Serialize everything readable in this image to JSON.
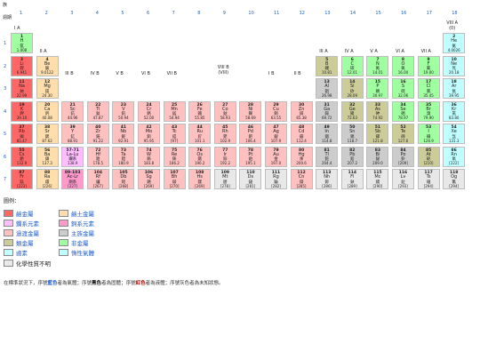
{
  "chart_data": {
    "type": "table",
    "corner_top": "族",
    "corner_period": "週期",
    "groups": [
      "1",
      "2",
      "3",
      "4",
      "5",
      "6",
      "7",
      "8",
      "9",
      "10",
      "11",
      "12",
      "13",
      "14",
      "15",
      "16",
      "17",
      "18"
    ],
    "periods": [
      "1",
      "2",
      "3",
      "4",
      "5",
      "6",
      "7"
    ],
    "group_headers": {
      "1": "I A",
      "2": "II A",
      "3": "III B",
      "4": "IV B",
      "5": "V B",
      "6": "VI B",
      "7": "VII B",
      "9": "VIII B\n(VIII)",
      "11": "I B",
      "12": "II B",
      "13": "III A",
      "14": "IV A",
      "15": "V A",
      "16": "VI A",
      "17": "VII A",
      "18": "VIII A\n(0)"
    },
    "elements": [
      {
        "z": "1",
        "sym": "H",
        "name": "氫",
        "mass": "1.008",
        "g": 1,
        "p": 1,
        "cat": "nonmetal"
      },
      {
        "z": "2",
        "sym": "He",
        "name": "氦",
        "mass": "4.0026",
        "g": 18,
        "p": 1,
        "cat": "noble"
      },
      {
        "z": "3",
        "sym": "Li",
        "name": "鋰",
        "mass": "6.941",
        "g": 1,
        "p": 2,
        "cat": "alkali"
      },
      {
        "z": "4",
        "sym": "Be",
        "name": "鈹",
        "mass": "9.0122",
        "g": 2,
        "p": 2,
        "cat": "alkaline"
      },
      {
        "z": "5",
        "sym": "B",
        "name": "硼",
        "mass": "10.81",
        "g": 13,
        "p": 2,
        "cat": "metalloid"
      },
      {
        "z": "6",
        "sym": "C",
        "name": "碳",
        "mass": "12.01",
        "g": 14,
        "p": 2,
        "cat": "nonmetal"
      },
      {
        "z": "7",
        "sym": "N",
        "name": "氮",
        "mass": "14.01",
        "g": 15,
        "p": 2,
        "cat": "nonmetal"
      },
      {
        "z": "8",
        "sym": "O",
        "name": "氧",
        "mass": "16.00",
        "g": 16,
        "p": 2,
        "cat": "nonmetal"
      },
      {
        "z": "9",
        "sym": "F",
        "name": "氟",
        "mass": "19.00",
        "g": 17,
        "p": 2,
        "cat": "nonmetal"
      },
      {
        "z": "10",
        "sym": "Ne",
        "name": "氖",
        "mass": "20.18",
        "g": 18,
        "p": 2,
        "cat": "noble"
      },
      {
        "z": "11",
        "sym": "Na",
        "name": "鈉",
        "mass": "22.99",
        "g": 1,
        "p": 3,
        "cat": "alkali"
      },
      {
        "z": "12",
        "sym": "Mg",
        "name": "鎂",
        "mass": "24.30",
        "g": 2,
        "p": 3,
        "cat": "alkaline"
      },
      {
        "z": "13",
        "sym": "Al",
        "name": "鋁",
        "mass": "26.98",
        "g": 13,
        "p": 3,
        "cat": "poor"
      },
      {
        "z": "14",
        "sym": "Si",
        "name": "矽",
        "mass": "28.09",
        "g": 14,
        "p": 3,
        "cat": "metalloid"
      },
      {
        "z": "15",
        "sym": "P",
        "name": "磷",
        "mass": "30.97",
        "g": 15,
        "p": 3,
        "cat": "nonmetal"
      },
      {
        "z": "16",
        "sym": "S",
        "name": "硫",
        "mass": "32.06",
        "g": 16,
        "p": 3,
        "cat": "nonmetal"
      },
      {
        "z": "17",
        "sym": "Cl",
        "name": "氯",
        "mass": "35.45",
        "g": 17,
        "p": 3,
        "cat": "nonmetal"
      },
      {
        "z": "18",
        "sym": "Ar",
        "name": "氬",
        "mass": "39.95",
        "g": 18,
        "p": 3,
        "cat": "noble"
      },
      {
        "z": "19",
        "sym": "K",
        "name": "鉀",
        "mass": "39.10",
        "g": 1,
        "p": 4,
        "cat": "alkali"
      },
      {
        "z": "20",
        "sym": "Ca",
        "name": "鈣",
        "mass": "40.08",
        "g": 2,
        "p": 4,
        "cat": "alkaline"
      },
      {
        "z": "21",
        "sym": "Sc",
        "name": "鈧",
        "mass": "44.96",
        "g": 3,
        "p": 4,
        "cat": "transition"
      },
      {
        "z": "22",
        "sym": "Ti",
        "name": "鈦",
        "mass": "47.87",
        "g": 4,
        "p": 4,
        "cat": "transition"
      },
      {
        "z": "23",
        "sym": "V",
        "name": "釩",
        "mass": "50.94",
        "g": 5,
        "p": 4,
        "cat": "transition"
      },
      {
        "z": "24",
        "sym": "Cr",
        "name": "鉻",
        "mass": "52.00",
        "g": 6,
        "p": 4,
        "cat": "transition"
      },
      {
        "z": "25",
        "sym": "Mn",
        "name": "錳",
        "mass": "54.94",
        "g": 7,
        "p": 4,
        "cat": "transition"
      },
      {
        "z": "26",
        "sym": "Fe",
        "name": "鐵",
        "mass": "55.85",
        "g": 8,
        "p": 4,
        "cat": "transition"
      },
      {
        "z": "27",
        "sym": "Co",
        "name": "鈷",
        "mass": "58.93",
        "g": 9,
        "p": 4,
        "cat": "transition"
      },
      {
        "z": "28",
        "sym": "Ni",
        "name": "鎳",
        "mass": "58.69",
        "g": 10,
        "p": 4,
        "cat": "transition"
      },
      {
        "z": "29",
        "sym": "Cu",
        "name": "銅",
        "mass": "63.55",
        "g": 11,
        "p": 4,
        "cat": "transition"
      },
      {
        "z": "30",
        "sym": "Zn",
        "name": "鋅",
        "mass": "65.38",
        "g": 12,
        "p": 4,
        "cat": "transition"
      },
      {
        "z": "31",
        "sym": "Ga",
        "name": "鎵",
        "mass": "69.72",
        "g": 13,
        "p": 4,
        "cat": "poor"
      },
      {
        "z": "32",
        "sym": "Ge",
        "name": "鍺",
        "mass": "72.63",
        "g": 14,
        "p": 4,
        "cat": "metalloid"
      },
      {
        "z": "33",
        "sym": "As",
        "name": "砷",
        "mass": "74.92",
        "g": 15,
        "p": 4,
        "cat": "metalloid"
      },
      {
        "z": "34",
        "sym": "Se",
        "name": "硒",
        "mass": "78.97",
        "g": 16,
        "p": 4,
        "cat": "nonmetal"
      },
      {
        "z": "35",
        "sym": "Br",
        "name": "溴",
        "mass": "79.90",
        "g": 17,
        "p": 4,
        "cat": "nonmetal"
      },
      {
        "z": "36",
        "sym": "Kr",
        "name": "氪",
        "mass": "83.80",
        "g": 18,
        "p": 4,
        "cat": "noble"
      },
      {
        "z": "37",
        "sym": "Rb",
        "name": "銣",
        "mass": "85.47",
        "g": 1,
        "p": 5,
        "cat": "alkali"
      },
      {
        "z": "38",
        "sym": "Sr",
        "name": "鍶",
        "mass": "87.62",
        "g": 2,
        "p": 5,
        "cat": "alkaline"
      },
      {
        "z": "39",
        "sym": "Y",
        "name": "釔",
        "mass": "88.91",
        "g": 3,
        "p": 5,
        "cat": "transition"
      },
      {
        "z": "40",
        "sym": "Zr",
        "name": "鋯",
        "mass": "91.22",
        "g": 4,
        "p": 5,
        "cat": "transition"
      },
      {
        "z": "41",
        "sym": "Nb",
        "name": "鈮",
        "mass": "92.91",
        "g": 5,
        "p": 5,
        "cat": "transition"
      },
      {
        "z": "42",
        "sym": "Mo",
        "name": "鉬",
        "mass": "95.95",
        "g": 6,
        "p": 5,
        "cat": "transition"
      },
      {
        "z": "43",
        "sym": "Tc",
        "name": "鎝",
        "mass": "[97]",
        "g": 7,
        "p": 5,
        "cat": "transition"
      },
      {
        "z": "44",
        "sym": "Ru",
        "name": "釕",
        "mass": "101.1",
        "g": 8,
        "p": 5,
        "cat": "transition"
      },
      {
        "z": "45",
        "sym": "Rh",
        "name": "銠",
        "mass": "102.9",
        "g": 9,
        "p": 5,
        "cat": "transition"
      },
      {
        "z": "46",
        "sym": "Pd",
        "name": "鈀",
        "mass": "106.4",
        "g": 10,
        "p": 5,
        "cat": "transition"
      },
      {
        "z": "47",
        "sym": "Ag",
        "name": "銀",
        "mass": "107.9",
        "g": 11,
        "p": 5,
        "cat": "transition"
      },
      {
        "z": "48",
        "sym": "Cd",
        "name": "鎘",
        "mass": "112.4",
        "g": 12,
        "p": 5,
        "cat": "transition"
      },
      {
        "z": "49",
        "sym": "In",
        "name": "銦",
        "mass": "114.8",
        "g": 13,
        "p": 5,
        "cat": "poor"
      },
      {
        "z": "50",
        "sym": "Sn",
        "name": "錫",
        "mass": "118.7",
        "g": 14,
        "p": 5,
        "cat": "poor"
      },
      {
        "z": "51",
        "sym": "Sb",
        "name": "銻",
        "mass": "121.8",
        "g": 15,
        "p": 5,
        "cat": "metalloid"
      },
      {
        "z": "52",
        "sym": "Te",
        "name": "碲",
        "mass": "127.6",
        "g": 16,
        "p": 5,
        "cat": "metalloid"
      },
      {
        "z": "53",
        "sym": "I",
        "name": "碘",
        "mass": "126.9",
        "g": 17,
        "p": 5,
        "cat": "nonmetal"
      },
      {
        "z": "54",
        "sym": "Xe",
        "name": "氙",
        "mass": "131.3",
        "g": 18,
        "p": 5,
        "cat": "noble"
      },
      {
        "z": "55",
        "sym": "Cs",
        "name": "銫",
        "mass": "132.9",
        "g": 1,
        "p": 6,
        "cat": "alkali"
      },
      {
        "z": "56",
        "sym": "Ba",
        "name": "鋇",
        "mass": "137.3",
        "g": 2,
        "p": 6,
        "cat": "alkaline"
      },
      {
        "z": "57-71",
        "sym": "La-Lu",
        "name": "鑭系",
        "mass": "138.9",
        "g": 3,
        "p": 6,
        "cat": "lanthanide"
      },
      {
        "z": "72",
        "sym": "Hf",
        "name": "鉿",
        "mass": "178.5",
        "g": 4,
        "p": 6,
        "cat": "transition"
      },
      {
        "z": "73",
        "sym": "Ta",
        "name": "鉭",
        "mass": "180.9",
        "g": 5,
        "p": 6,
        "cat": "transition"
      },
      {
        "z": "74",
        "sym": "W",
        "name": "鎢",
        "mass": "183.8",
        "g": 6,
        "p": 6,
        "cat": "transition"
      },
      {
        "z": "75",
        "sym": "Re",
        "name": "錸",
        "mass": "186.2",
        "g": 7,
        "p": 6,
        "cat": "transition"
      },
      {
        "z": "76",
        "sym": "Os",
        "name": "鋨",
        "mass": "190.2",
        "g": 8,
        "p": 6,
        "cat": "transition"
      },
      {
        "z": "77",
        "sym": "Ir",
        "name": "銥",
        "mass": "192.2",
        "g": 9,
        "p": 6,
        "cat": "transition"
      },
      {
        "z": "78",
        "sym": "Pt",
        "name": "鉑",
        "mass": "195.1",
        "g": 10,
        "p": 6,
        "cat": "transition"
      },
      {
        "z": "79",
        "sym": "Au",
        "name": "金",
        "mass": "197.0",
        "g": 11,
        "p": 6,
        "cat": "transition"
      },
      {
        "z": "80",
        "sym": "Hg",
        "name": "汞",
        "mass": "200.6",
        "g": 12,
        "p": 6,
        "cat": "transition"
      },
      {
        "z": "81",
        "sym": "Tl",
        "name": "鉈",
        "mass": "204.4",
        "g": 13,
        "p": 6,
        "cat": "poor"
      },
      {
        "z": "82",
        "sym": "Pb",
        "name": "鉛",
        "mass": "207.2",
        "g": 14,
        "p": 6,
        "cat": "poor"
      },
      {
        "z": "83",
        "sym": "Bi",
        "name": "鉍",
        "mass": "209.0",
        "g": 15,
        "p": 6,
        "cat": "poor"
      },
      {
        "z": "84",
        "sym": "Po",
        "name": "釙",
        "mass": "[209]",
        "g": 16,
        "p": 6,
        "cat": "poor"
      },
      {
        "z": "85",
        "sym": "At",
        "name": "砈",
        "mass": "[210]",
        "g": 17,
        "p": 6,
        "cat": "metalloid"
      },
      {
        "z": "86",
        "sym": "Rn",
        "name": "氡",
        "mass": "[222]",
        "g": 18,
        "p": 6,
        "cat": "noble"
      },
      {
        "z": "87",
        "sym": "Fr",
        "name": "鍅",
        "mass": "[223]",
        "g": 1,
        "p": 7,
        "cat": "alkali"
      },
      {
        "z": "88",
        "sym": "Ra",
        "name": "鐳",
        "mass": "[226]",
        "g": 2,
        "p": 7,
        "cat": "alkaline"
      },
      {
        "z": "89-103",
        "sym": "Ac-Lr",
        "name": "錒系",
        "mass": "[227]",
        "g": 3,
        "p": 7,
        "cat": "actinide"
      },
      {
        "z": "104",
        "sym": "Rf",
        "name": "鑪",
        "mass": "[267]",
        "g": 4,
        "p": 7,
        "cat": "transition"
      },
      {
        "z": "105",
        "sym": "Db",
        "name": "𨧀",
        "mass": "[268]",
        "g": 5,
        "p": 7,
        "cat": "transition"
      },
      {
        "z": "106",
        "sym": "Sg",
        "name": "𨭎",
        "mass": "[269]",
        "g": 6,
        "p": 7,
        "cat": "transition"
      },
      {
        "z": "107",
        "sym": "Bh",
        "name": "𨨏",
        "mass": "[270]",
        "g": 7,
        "p": 7,
        "cat": "transition"
      },
      {
        "z": "108",
        "sym": "Hs",
        "name": "𨭆",
        "mass": "[269]",
        "g": 8,
        "p": 7,
        "cat": "transition"
      },
      {
        "z": "109",
        "sym": "Mt",
        "name": "䥑",
        "mass": "[278]",
        "g": 9,
        "p": 7,
        "cat": "unknown"
      },
      {
        "z": "110",
        "sym": "Ds",
        "name": "鐽",
        "mass": "[281]",
        "g": 10,
        "p": 7,
        "cat": "unknown"
      },
      {
        "z": "111",
        "sym": "Rg",
        "name": "錀",
        "mass": "[282]",
        "g": 11,
        "p": 7,
        "cat": "unknown"
      },
      {
        "z": "112",
        "sym": "Cn",
        "name": "鎶",
        "mass": "[285]",
        "g": 12,
        "p": 7,
        "cat": "transition"
      },
      {
        "z": "113",
        "sym": "Nh",
        "name": "鉨",
        "mass": "[286]",
        "g": 13,
        "p": 7,
        "cat": "unknown"
      },
      {
        "z": "114",
        "sym": "Fl",
        "name": "鈇",
        "mass": "[289]",
        "g": 14,
        "p": 7,
        "cat": "unknown"
      },
      {
        "z": "115",
        "sym": "Mc",
        "name": "鏌",
        "mass": "[290]",
        "g": 15,
        "p": 7,
        "cat": "unknown"
      },
      {
        "z": "116",
        "sym": "Lv",
        "name": "鉝",
        "mass": "[293]",
        "g": 16,
        "p": 7,
        "cat": "unknown"
      },
      {
        "z": "117",
        "sym": "Ts",
        "name": "鿬",
        "mass": "[294]",
        "g": 17,
        "p": 7,
        "cat": "unknown"
      },
      {
        "z": "118",
        "sym": "Og",
        "name": "鿫",
        "mass": "[294]",
        "g": 18,
        "p": 7,
        "cat": "unknown"
      }
    ],
    "colors": {
      "alkali": "#ff6666",
      "alkaline": "#ffdead",
      "lanthanide": "#ffbfff",
      "actinide": "#ff99cc",
      "transition": "#ffc0c0",
      "poor": "#cccccc",
      "metalloid": "#cccc99",
      "nonmetal": "#a0ffa0",
      "noble": "#c0ffff",
      "unknown": "#e8e8e8"
    }
  },
  "legend": {
    "title": "圖例：",
    "items": [
      {
        "key": "alkali",
        "label": "鹼金屬"
      },
      {
        "key": "alkaline",
        "label": "鹼土金屬"
      },
      {
        "key": "lanthanide",
        "label": "鑭系元素"
      },
      {
        "key": "actinide",
        "label": "錒系元素"
      },
      {
        "key": "transition",
        "label": "過渡金屬"
      },
      {
        "key": "poor",
        "label": "主族金屬"
      },
      {
        "key": "metalloid",
        "label": "類金屬"
      },
      {
        "key": "nonmetal",
        "label": "非金屬"
      },
      {
        "key": "noble",
        "label": "鹵素"
      },
      {
        "key": "noble",
        "label": "惰性氣體"
      },
      {
        "key": "unknown",
        "label": "化學性質不明"
      }
    ]
  },
  "footer": {
    "prefix": "在標準狀況下，序號",
    "blue_word": "藍色",
    "mid1": "者為氣體；序號",
    "black_word": "黑色",
    "mid2": "者為固體；序號",
    "red_word": "紅色",
    "mid3": "者為液體；序號灰色者為未知狀態。"
  }
}
